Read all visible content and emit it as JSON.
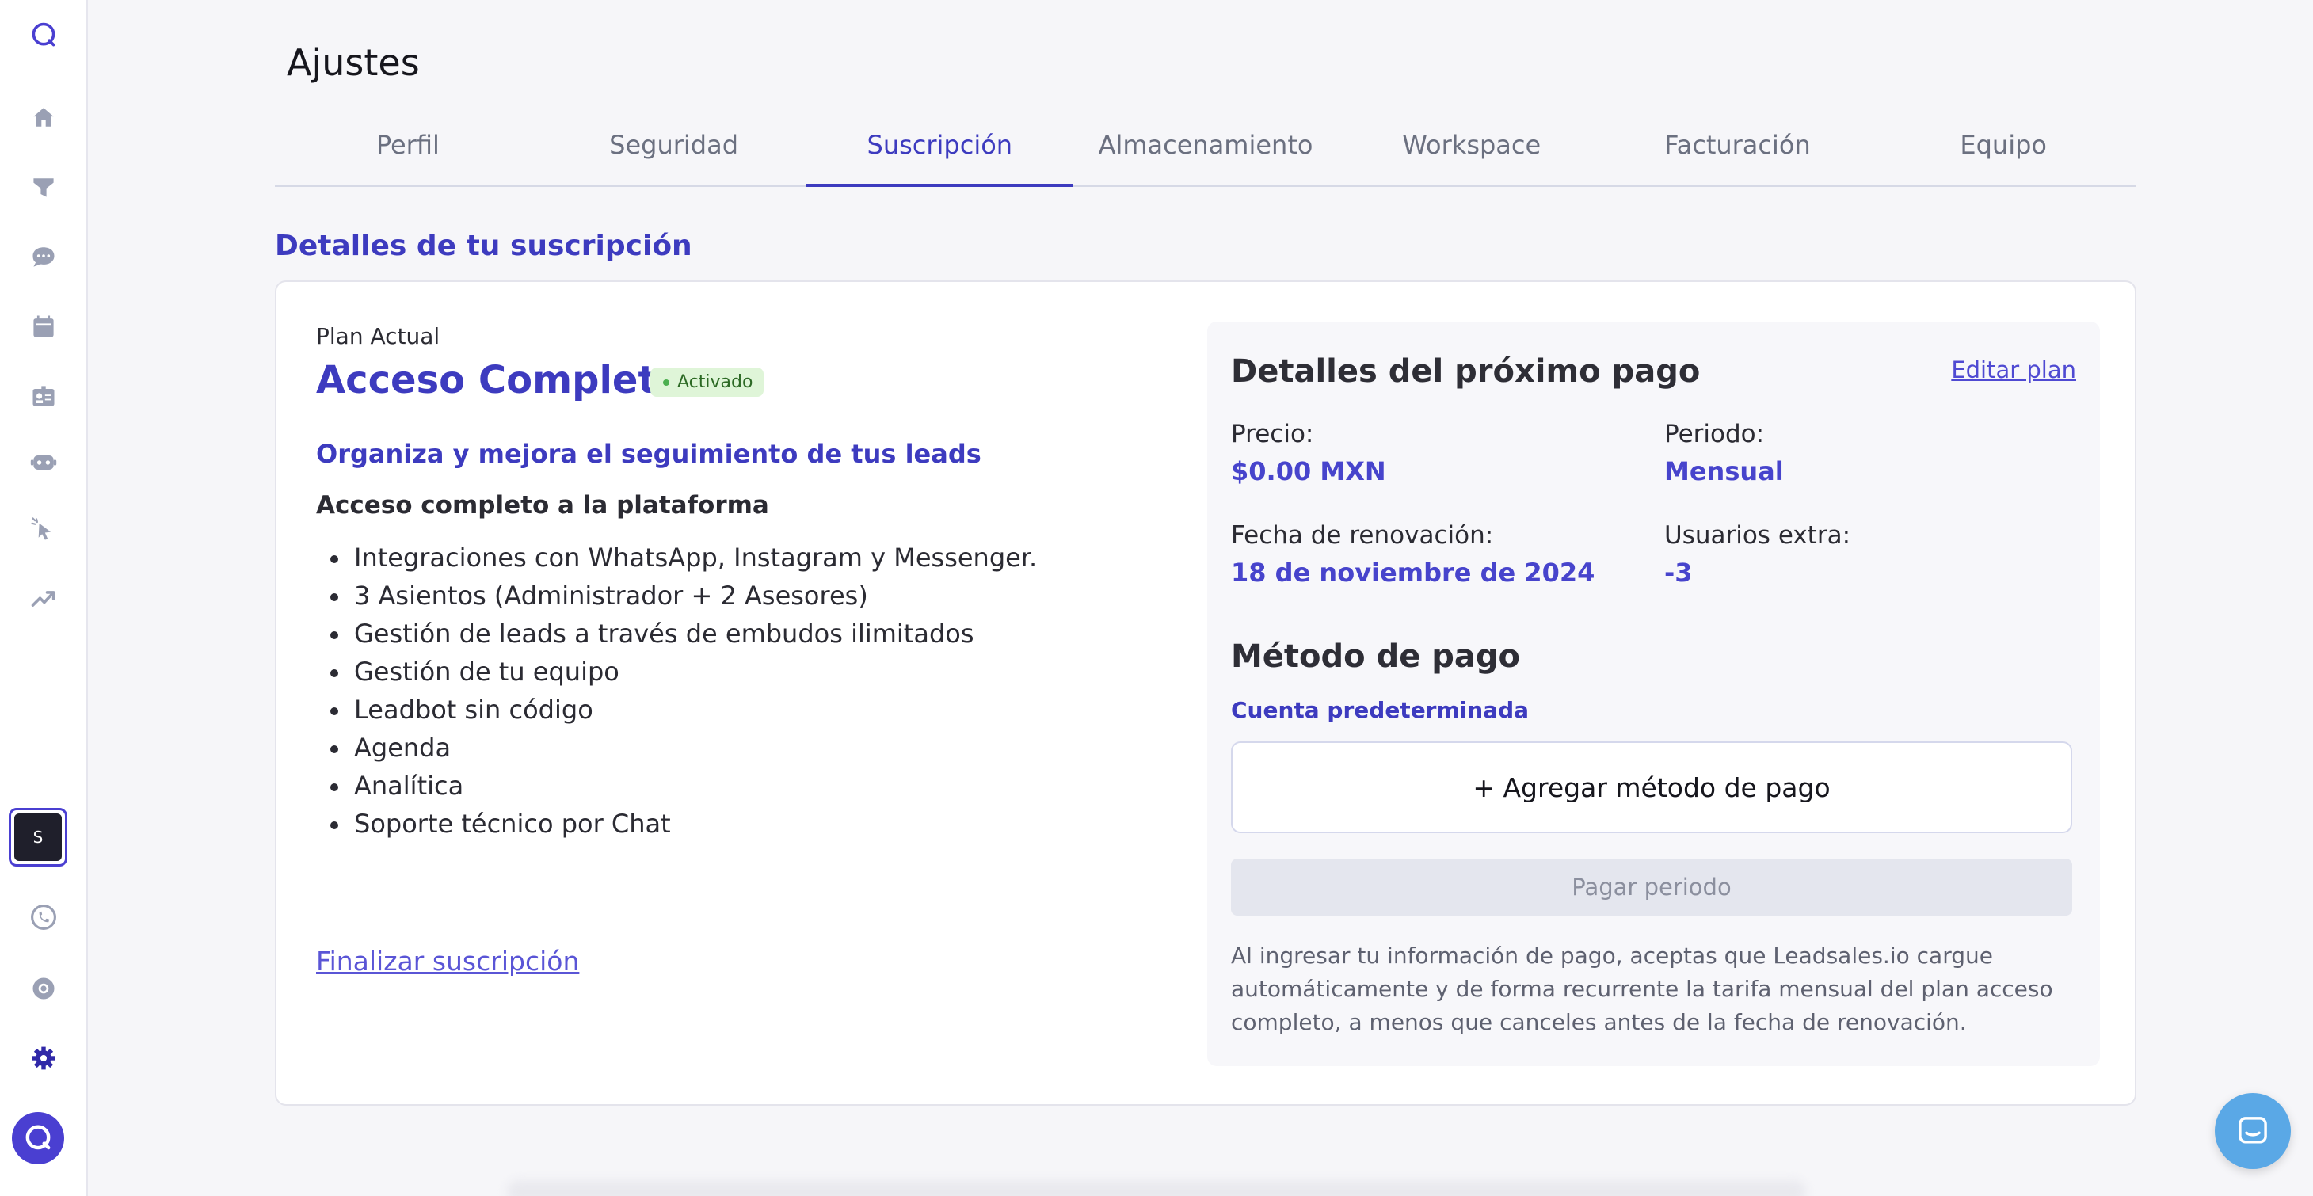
{
  "sidebar": {
    "workspace_initial": "S"
  },
  "header": {
    "title": "Ajustes"
  },
  "tabs": [
    {
      "label": "Perfil"
    },
    {
      "label": "Seguridad"
    },
    {
      "label": "Suscripción"
    },
    {
      "label": "Almacenamiento"
    },
    {
      "label": "Workspace"
    },
    {
      "label": "Facturación"
    },
    {
      "label": "Equipo"
    }
  ],
  "active_tab": "Suscripción",
  "section_title": "Detalles de tu suscripción",
  "plan": {
    "label": "Plan Actual",
    "name": "Acceso Completo",
    "status": "Activado",
    "subtitle": "Organiza y mejora el seguimiento de tus leads",
    "heading": "Acceso completo a la plataforma",
    "features": [
      "Integraciones con WhatsApp, Instagram y Messenger.",
      "3 Asientos (Administrador + 2 Asesores)",
      "Gestión de leads a través de embudos ilimitados",
      "Gestión de tu equipo",
      "Leadbot sin código",
      "Agenda",
      "Analítica",
      "Soporte técnico por Chat"
    ],
    "finalize_label": "Finalizar suscripción"
  },
  "payment": {
    "title": "Detalles del próximo pago",
    "edit_label": "Editar plan",
    "price_label": "Precio:",
    "price_value": "$0.00 MXN",
    "period_label": "Periodo:",
    "period_value": "Mensual",
    "renewal_label": "Fecha de renovación:",
    "renewal_value": "18 de noviembre de 2024",
    "extra_users_label": "Usuarios extra:",
    "extra_users_value": "-3",
    "method_title": "Método de pago",
    "default_account": "Cuenta predeterminada",
    "add_method_label": "+ Agregar método de pago",
    "pay_period_label": "Pagar periodo",
    "disclaimer": "Al ingresar tu información de pago, aceptas que Leadsales.io cargue automáticamente y de forma recurrente la tarifa mensual del plan acceso completo, a menos que canceles antes de la fecha de renovación."
  },
  "colors": {
    "accent": "#3d3bbf",
    "badge_bg": "#dff5d8",
    "chat_button": "#5aa8e6"
  }
}
